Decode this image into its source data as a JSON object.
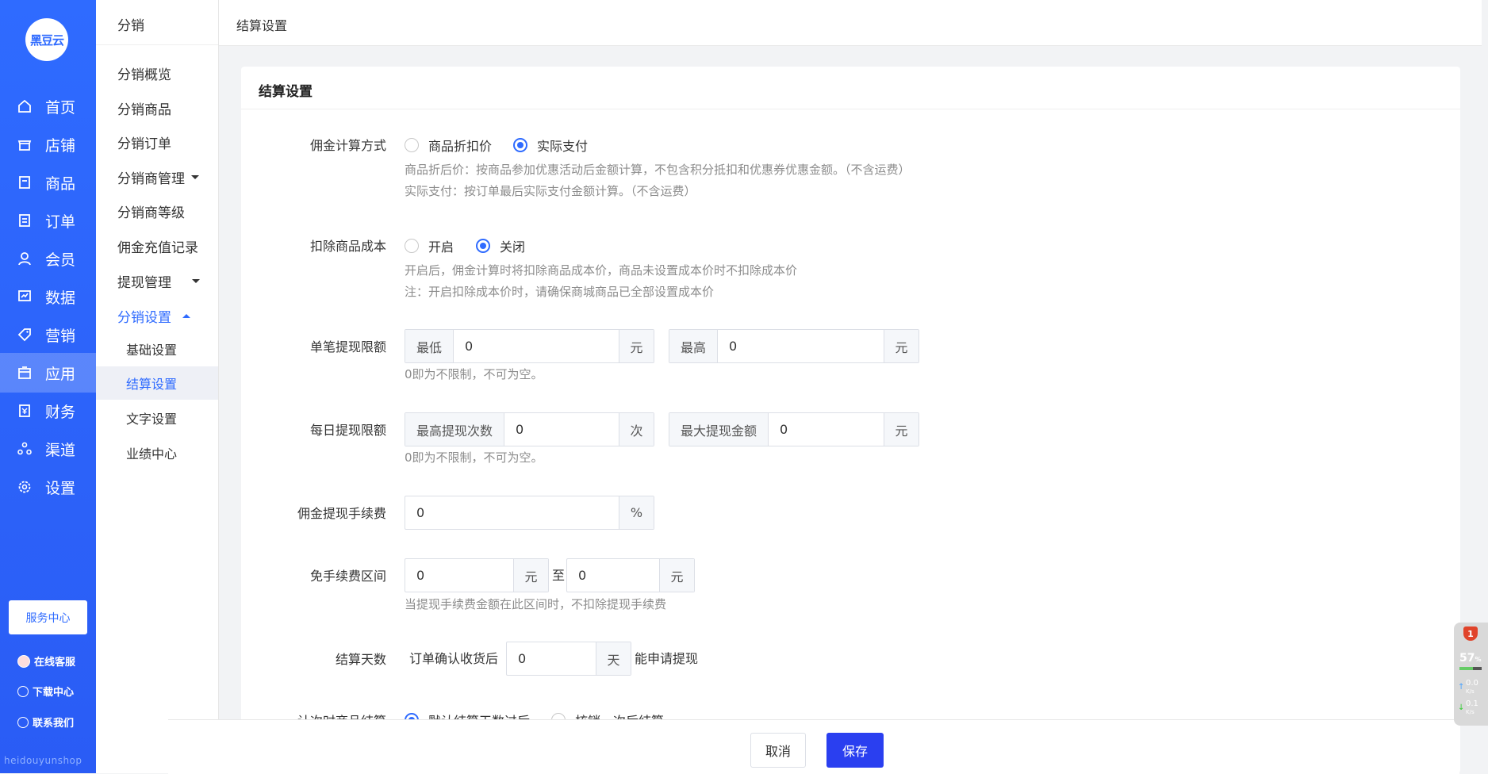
{
  "brand": {
    "logo_text": "黑豆云",
    "watermark": "heidouyunshop"
  },
  "nav_primary": [
    {
      "label": "首页",
      "icon": "home-icon"
    },
    {
      "label": "店铺",
      "icon": "store-icon"
    },
    {
      "label": "商品",
      "icon": "goods-icon"
    },
    {
      "label": "订单",
      "icon": "order-icon"
    },
    {
      "label": "会员",
      "icon": "member-icon"
    },
    {
      "label": "数据",
      "icon": "data-icon"
    },
    {
      "label": "营销",
      "icon": "tag-icon"
    },
    {
      "label": "应用",
      "icon": "app-icon",
      "active": true
    },
    {
      "label": "财务",
      "icon": "finance-icon"
    },
    {
      "label": "渠道",
      "icon": "channel-icon"
    },
    {
      "label": "设置",
      "icon": "gear-icon"
    }
  ],
  "service_center": "服务中心",
  "nav_primary_bottom": [
    {
      "label": "在线客服",
      "icon": "avatar-icon"
    },
    {
      "label": "下载中心",
      "icon": "download-icon"
    },
    {
      "label": "联系我们",
      "icon": "contact-icon"
    }
  ],
  "nav_secondary": {
    "title": "分销",
    "items": [
      "分销概览",
      "分销商品",
      "分销订单",
      "分销商管理",
      "分销商等级",
      "佣金充值记录",
      "提现管理",
      "分销设置"
    ],
    "sub_items": [
      "基础设置",
      "结算设置",
      "文字设置",
      "业绩中心"
    ],
    "active_sub": "结算设置"
  },
  "header": {
    "title": "结算设置"
  },
  "card": {
    "title": "结算设置"
  },
  "form": {
    "commission_method": {
      "label": "佣金计算方式",
      "options": [
        "商品折扣价",
        "实际支付"
      ],
      "selected": "实际支付",
      "hint1": "商品折后价：按商品参加优惠活动后金额计算，不包含积分抵扣和优惠券优惠金额。（不含运费）",
      "hint2": "实际支付：按订单最后实际支付金额计算。（不含运费）"
    },
    "deduct_cost": {
      "label": "扣除商品成本",
      "options": [
        "开启",
        "关闭"
      ],
      "selected": "关闭",
      "hint1": "开启后，佣金计算时将扣除商品成本价，商品未设置成本价时不扣除成本价",
      "hint2": "注：开启扣除成本价时，请确保商城商品已全部设置成本价"
    },
    "single_limit": {
      "label": "单笔提现限额",
      "min_prefix": "最低",
      "min_value": "0",
      "min_suffix": "元",
      "max_prefix": "最高",
      "max_value": "0",
      "max_suffix": "元",
      "hint": "0即为不限制，不可为空。"
    },
    "daily_limit": {
      "label": "每日提现限额",
      "count_prefix": "最高提现次数",
      "count_value": "0",
      "count_suffix": "次",
      "amount_prefix": "最大提现金额",
      "amount_value": "0",
      "amount_suffix": "元",
      "hint": "0即为不限制，不可为空。"
    },
    "fee": {
      "label": "佣金提现手续费",
      "value": "0",
      "suffix": "%"
    },
    "free_range": {
      "label": "免手续费区间",
      "from_value": "0",
      "from_suffix": "元",
      "to_text": "至",
      "to_value": "0",
      "to_suffix": "元",
      "hint": "当提现手续费金额在此区间时，不扣除提现手续费"
    },
    "settle_days": {
      "label": "结算天数",
      "prefix": "订单确认收货后",
      "value": "0",
      "suffix": "天",
      "after": "能申请提现"
    },
    "timed_goods": {
      "label": "计次时商品结算",
      "options": [
        "默认结算天数过后",
        "核销一次后结算"
      ],
      "selected": "默认结算天数过后"
    }
  },
  "footer": {
    "cancel": "取消",
    "save": "保存"
  },
  "widget": {
    "badge": "1",
    "percent": "57",
    "percent_unit": "%",
    "up": "0.0",
    "down": "0.1",
    "unit": "K/s"
  },
  "colors": {
    "primary": "#2f6bff",
    "save_button": "#2a3ff0"
  }
}
